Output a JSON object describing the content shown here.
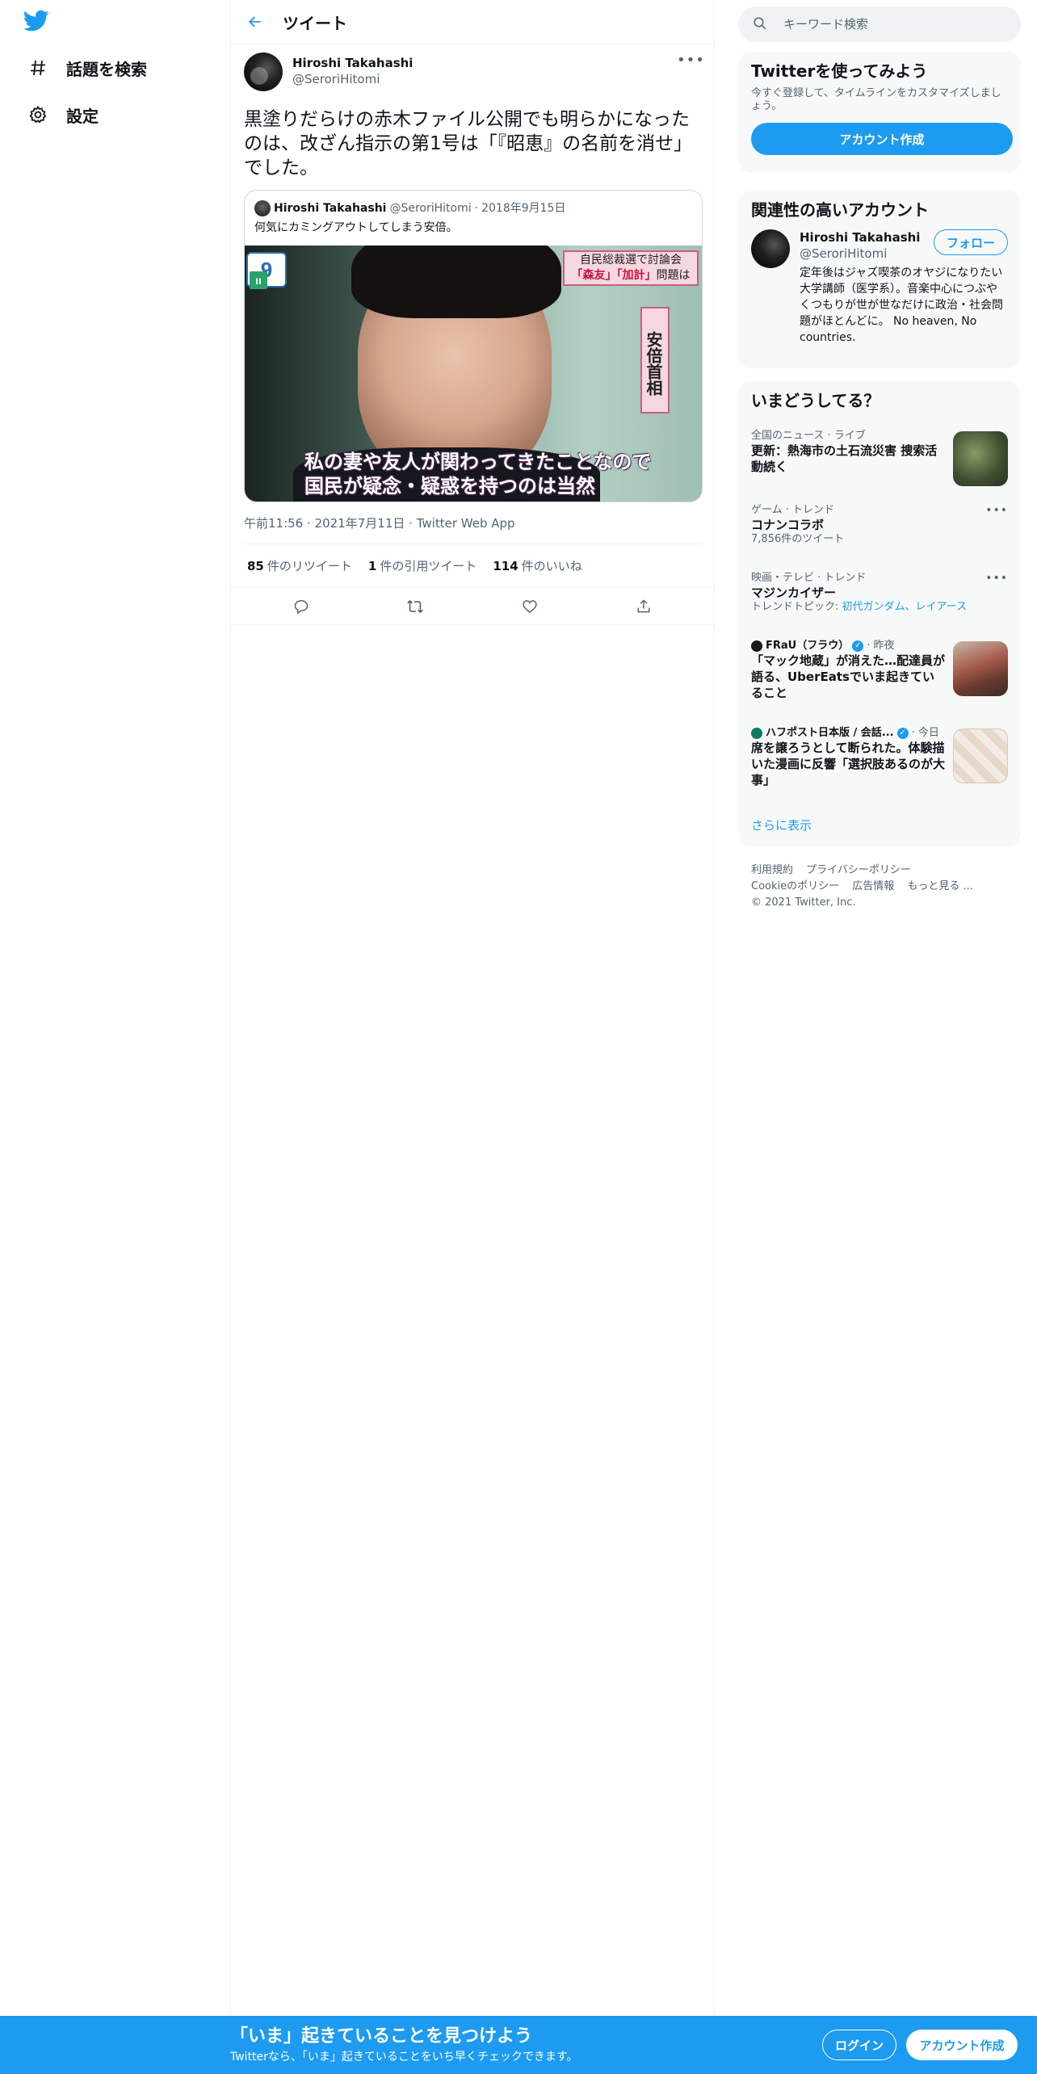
{
  "nav": {
    "logo": "twitter-bird-icon",
    "items": [
      {
        "label": "話題を検索",
        "icon": "hashtag-icon"
      },
      {
        "label": "設定",
        "icon": "gear-icon"
      }
    ]
  },
  "header": {
    "title": "ツイート"
  },
  "tweet": {
    "author_name": "Hiroshi Takahashi",
    "author_handle": "@SeroriHitomi",
    "text": "黒塗りだらけの赤木ファイル公開でも明らかになったのは、改ざん指示の第1号は「『昭恵』の名前を消せ」でした。",
    "quote": {
      "author_name": "Hiroshi Takahashi",
      "author_handle": "@SeroriHitomi",
      "dot": "·",
      "date": "2018年9月15日",
      "text": "何気にカミングアウトしてしまう安倍。",
      "media": {
        "logo": "9",
        "banner_line1": "自民総裁選で討論会",
        "banner_line2_a": "「森友」「加計」",
        "banner_line2_b": "問題は",
        "vertical_caption": "安倍首相",
        "caption_line1": "私の妻や友人が関わってきたことなので",
        "caption_line2": "国民が疑念・疑惑を持つのは当然"
      }
    },
    "time": "午前11:56",
    "date": "2021年7月11日",
    "source": "Twitter Web App",
    "meta_sep": "·",
    "stats": {
      "retweets_num": "85",
      "retweets_label": "件のリツイート",
      "quotes_num": "1",
      "quotes_label": "件の引用ツイート",
      "likes_num": "114",
      "likes_label": "件のいいね"
    }
  },
  "search": {
    "placeholder": "キーワード検索"
  },
  "signup_card": {
    "title": "Twitterを使ってみよう",
    "subtitle": "今すぐ登録して、タイムラインをカスタマイズしましょう。",
    "button": "アカウント作成"
  },
  "related": {
    "title": "関連性の高いアカウント",
    "user": {
      "name": "Hiroshi Takahashi",
      "handle": "@SeroriHitomi",
      "follow": "フォロー",
      "bio": "定年後はジャズ喫茶のオヤジになりたい大学講師（医学系）。音楽中心につぶやくつもりが世が世なだけに政治・社会問題がほとんどに。 No heaven, No countries."
    }
  },
  "trends": {
    "title": "いまどうしてる？",
    "items": [
      {
        "context": "全国のニュース · ライブ",
        "title": "更新：熱海市の土石流災害 捜索活動続く"
      },
      {
        "context": "ゲーム · トレンド",
        "title": "コナンコラボ",
        "sub": "7,856件のツイート"
      },
      {
        "context": "映画・テレビ · トレンド",
        "title": "マジンカイザー",
        "sub_prefix": "トレンドトピック: ",
        "sub_links": "初代ガンダム、レイアース"
      },
      {
        "source": "FRaU（フラウ）",
        "time": "· 昨夜",
        "title": "「マック地蔵」が消えた…配達員が語る、UberEatsでいま起きていること"
      },
      {
        "source": "ハフポスト日本版 / 会話...",
        "time": "· 今日",
        "title": "席を譲ろうとして断られた。体験描いた漫画に反響「選択肢あるのが大事」"
      }
    ],
    "show_more": "さらに表示"
  },
  "footer": {
    "links": [
      "利用規約",
      "プライバシーポリシー",
      "Cookieのポリシー",
      "広告情報",
      "もっと見る ..."
    ],
    "copyright": "© 2021 Twitter, Inc."
  },
  "bottom_bar": {
    "title": "「いま」起きていることを見つけよう",
    "subtitle": "Twitterなら、「いま」起きていることをいち早くチェックできます。",
    "login": "ログイン",
    "signup": "アカウント作成"
  },
  "colors": {
    "accent": "#1d9bf0",
    "text": "#0f1419",
    "secondary": "#536471"
  }
}
